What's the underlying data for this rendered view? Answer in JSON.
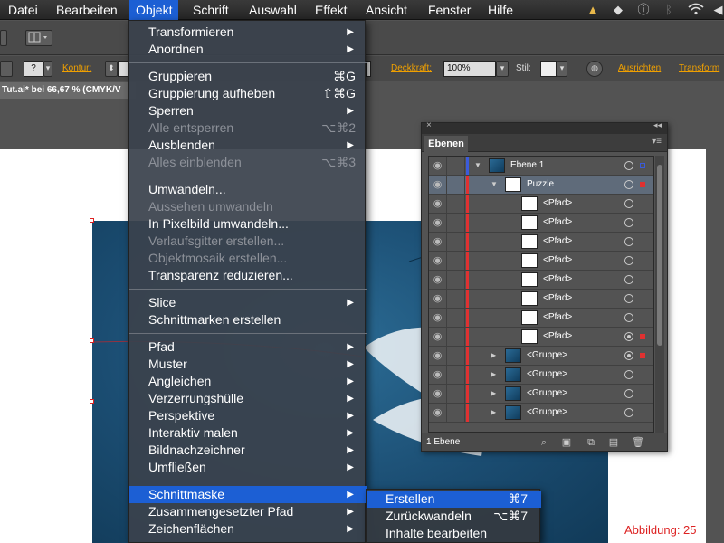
{
  "menubar": {
    "items": [
      "Datei",
      "Bearbeiten",
      "Objekt",
      "Schrift",
      "Auswahl",
      "Effekt",
      "Ansicht",
      "Fenster",
      "Hilfe"
    ],
    "active": "Objekt",
    "tray_icons": [
      "bell-icon",
      "dropbox-icon",
      "info-icon",
      "bluetooth-icon",
      "wifi-icon",
      "volume-icon"
    ]
  },
  "toolbar": {
    "kontur_label": "Kontur:",
    "deckkraft_label": "Deckkraft:",
    "deckkraft_value": "100%",
    "stil_label": "Stil:",
    "ausrichten_label": "Ausrichten",
    "transform_label": "Transform",
    "stroke_select": "?"
  },
  "document": {
    "tab_title": "Tut.ai* bei 66,67 % (CMYK/V"
  },
  "object_menu": {
    "groups": [
      [
        {
          "label": "Transformieren",
          "submenu": true
        },
        {
          "label": "Anordnen",
          "submenu": true
        }
      ],
      [
        {
          "label": "Gruppieren",
          "shortcut": "⌘G"
        },
        {
          "label": "Gruppierung aufheben",
          "shortcut": "⇧⌘G"
        },
        {
          "label": "Sperren",
          "submenu": true
        },
        {
          "label": "Alle entsperren",
          "shortcut": "⌥⌘2",
          "disabled": true
        },
        {
          "label": "Ausblenden",
          "submenu": true
        },
        {
          "label": "Alles einblenden",
          "shortcut": "⌥⌘3",
          "disabled": true
        }
      ],
      [
        {
          "label": "Umwandeln..."
        },
        {
          "label": "Aussehen umwandeln",
          "disabled": true
        },
        {
          "label": "In Pixelbild umwandeln..."
        },
        {
          "label": "Verlaufsgitter erstellen...",
          "disabled": true
        },
        {
          "label": "Objektmosaik erstellen...",
          "disabled": true
        },
        {
          "label": "Transparenz reduzieren..."
        }
      ],
      [
        {
          "label": "Slice",
          "submenu": true
        },
        {
          "label": "Schnittmarken erstellen"
        }
      ],
      [
        {
          "label": "Pfad",
          "submenu": true
        },
        {
          "label": "Muster",
          "submenu": true
        },
        {
          "label": "Angleichen",
          "submenu": true
        },
        {
          "label": "Verzerrungshülle",
          "submenu": true
        },
        {
          "label": "Perspektive",
          "submenu": true
        },
        {
          "label": "Interaktiv malen",
          "submenu": true
        },
        {
          "label": "Bildnachzeichner",
          "submenu": true
        },
        {
          "label": "Umfließen",
          "submenu": true
        }
      ],
      [
        {
          "label": "Schnittmaske",
          "submenu": true,
          "highlighted": true
        },
        {
          "label": "Zusammengesetzter Pfad",
          "submenu": true
        },
        {
          "label": "Zeichenflächen",
          "submenu": true
        }
      ]
    ]
  },
  "submenu": {
    "items": [
      {
        "label": "Erstellen",
        "shortcut": "⌘7",
        "highlighted": true
      },
      {
        "label": "Zurückwandeln",
        "shortcut": "⌥⌘7"
      },
      {
        "label": "Inhalte bearbeiten",
        "shortcut": ""
      }
    ]
  },
  "layers_panel": {
    "tab_label": "Ebenen",
    "footer_count": "1 Ebene",
    "rows": [
      {
        "name": "Ebene 1",
        "level": 0,
        "expanded": true,
        "thumb": "art",
        "target": false,
        "sel_color": "#3b5bdb",
        "bar_color": "#3b5bdb",
        "selected": false
      },
      {
        "name": "Puzzle",
        "level": 1,
        "expanded": true,
        "thumb": "grid",
        "target": false,
        "sel_color": "#e03131",
        "bar_color": "#e03131",
        "selected": true
      },
      {
        "name": "<Pfad>",
        "level": 2,
        "thumb": "white",
        "target": false,
        "bar_color": "#e03131"
      },
      {
        "name": "<Pfad>",
        "level": 2,
        "thumb": "white",
        "target": false,
        "bar_color": "#e03131"
      },
      {
        "name": "<Pfad>",
        "level": 2,
        "thumb": "white",
        "target": false,
        "bar_color": "#e03131"
      },
      {
        "name": "<Pfad>",
        "level": 2,
        "thumb": "white",
        "target": false,
        "bar_color": "#e03131"
      },
      {
        "name": "<Pfad>",
        "level": 2,
        "thumb": "white",
        "target": false,
        "bar_color": "#e03131"
      },
      {
        "name": "<Pfad>",
        "level": 2,
        "thumb": "white",
        "target": false,
        "bar_color": "#e03131"
      },
      {
        "name": "<Pfad>",
        "level": 2,
        "thumb": "white",
        "target": false,
        "bar_color": "#e03131"
      },
      {
        "name": "<Pfad>",
        "level": 2,
        "thumb": "white",
        "target": true,
        "sel_color": "#e03131",
        "bar_color": "#e03131"
      },
      {
        "name": "<Gruppe>",
        "level": 1,
        "expanded": false,
        "thumb": "art",
        "target": true,
        "sel_color": "#e03131",
        "bar_color": "#e03131"
      },
      {
        "name": "<Gruppe>",
        "level": 1,
        "expanded": false,
        "thumb": "art",
        "target": false,
        "bar_color": "#e03131"
      },
      {
        "name": "<Gruppe>",
        "level": 1,
        "expanded": false,
        "thumb": "art",
        "target": false,
        "bar_color": "#e03131"
      },
      {
        "name": "<Gruppe>",
        "level": 1,
        "expanded": false,
        "thumb": "art",
        "target": false,
        "bar_color": "#e03131"
      }
    ]
  },
  "caption": "Abbildung: 25"
}
